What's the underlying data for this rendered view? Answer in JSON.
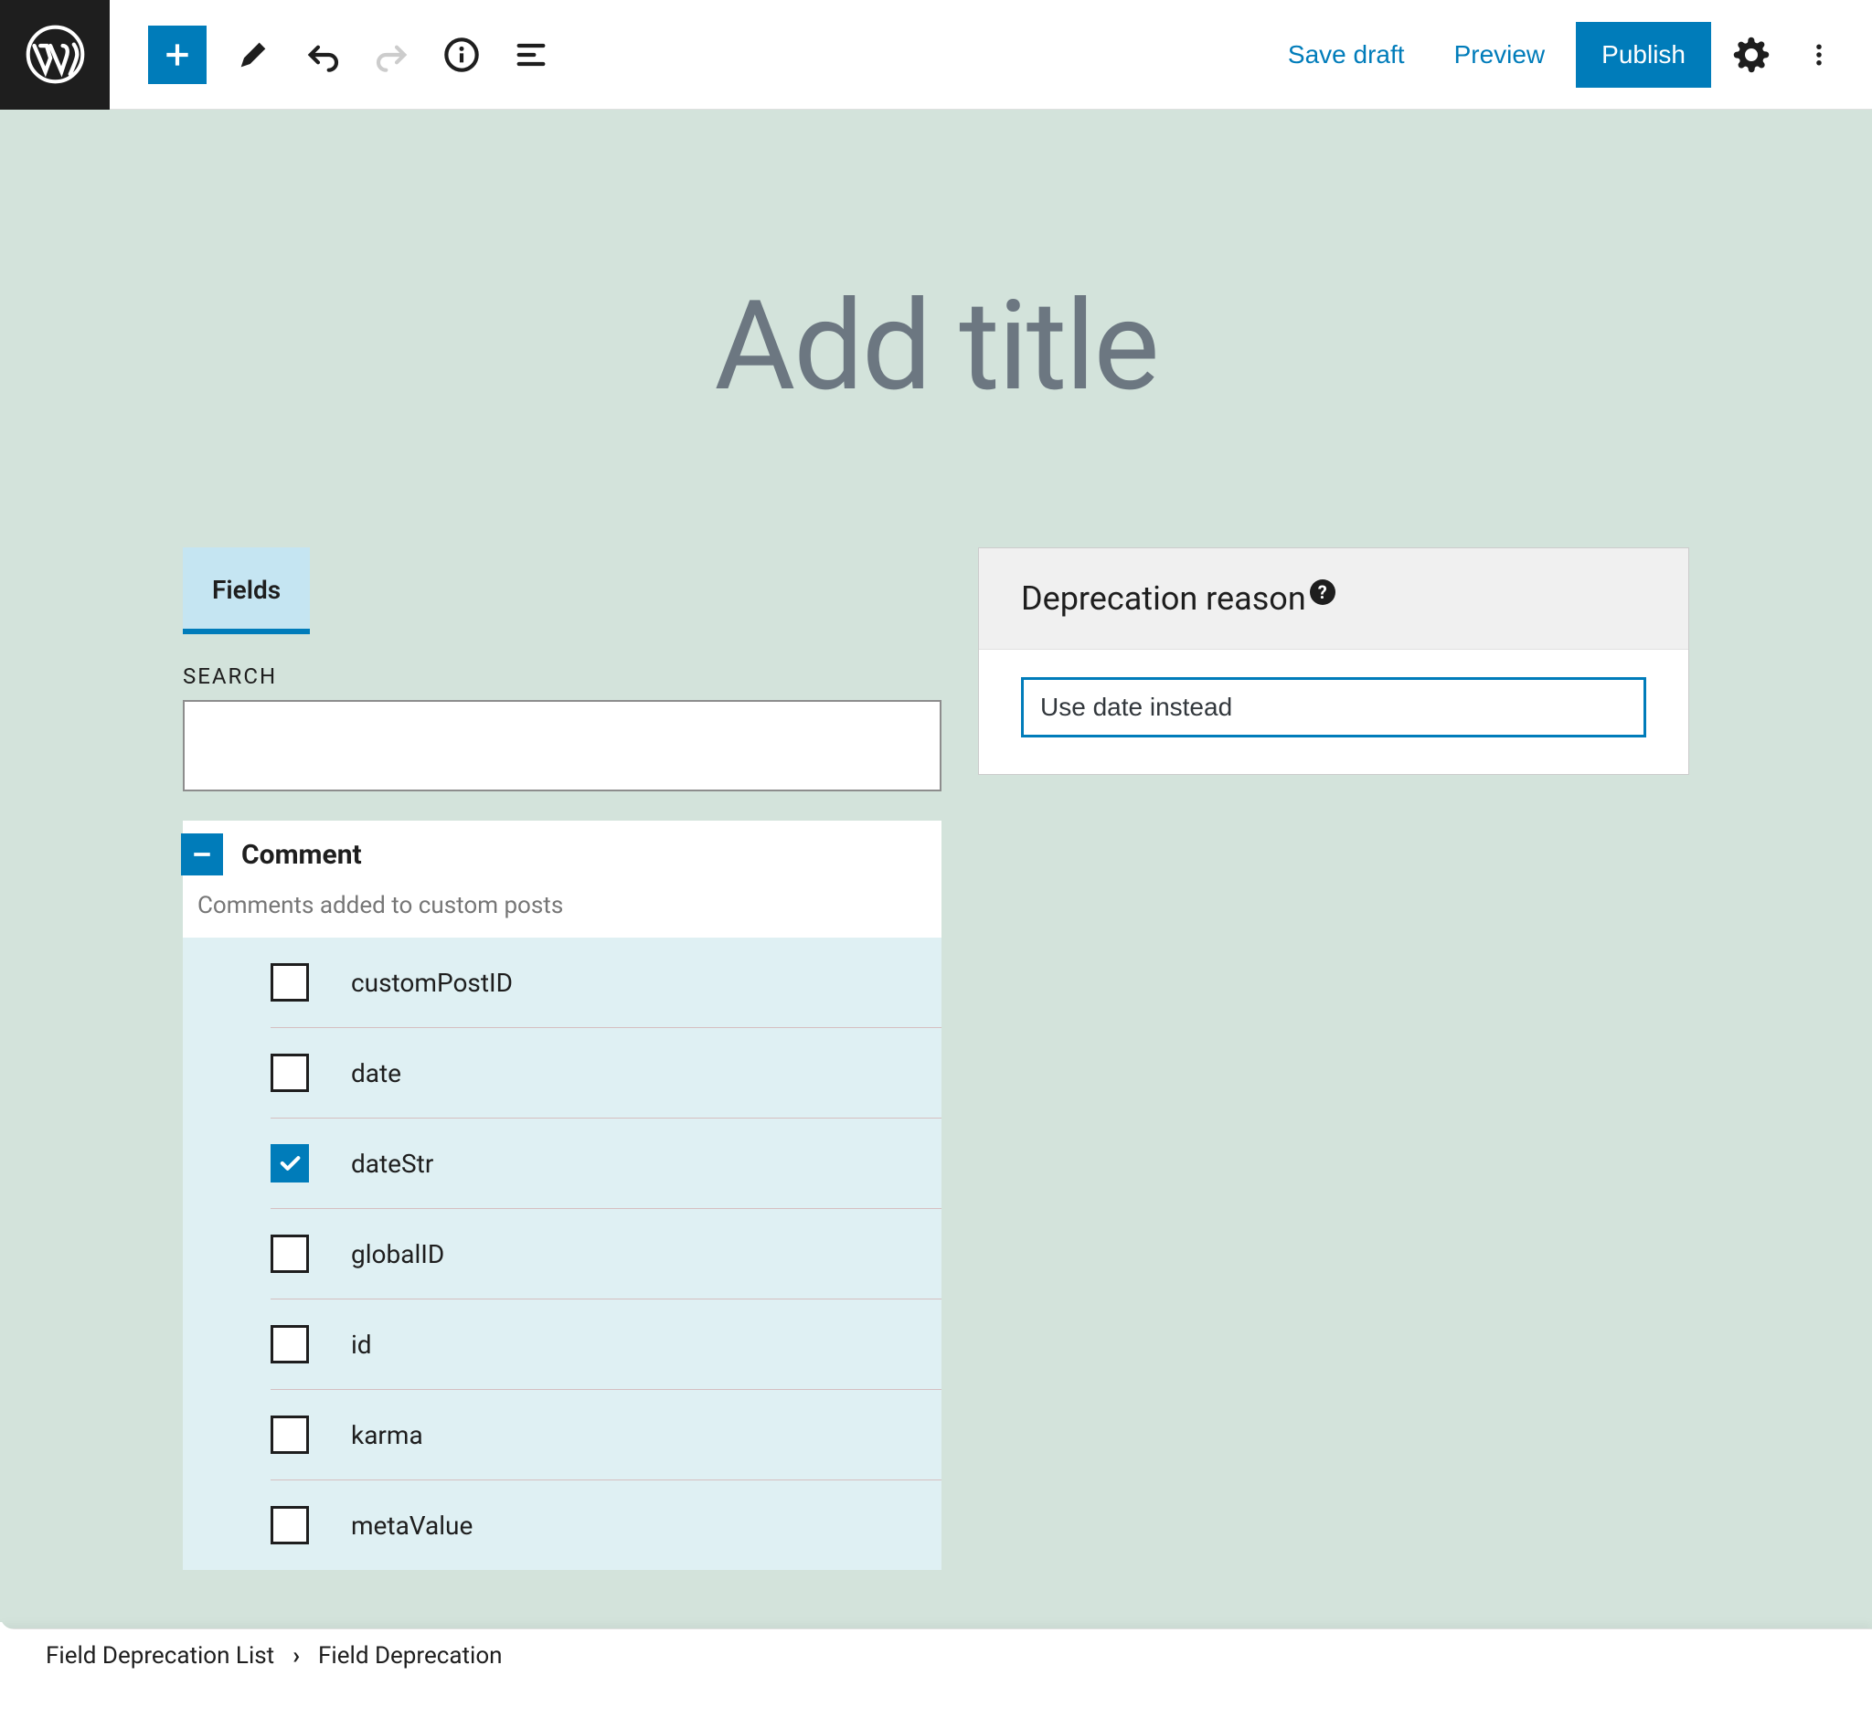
{
  "toolbar": {
    "save_draft": "Save draft",
    "preview": "Preview",
    "publish": "Publish"
  },
  "editor": {
    "title_placeholder": "Add title"
  },
  "fields_block": {
    "tab_label": "Fields",
    "search_label": "SEARCH",
    "search_value": "",
    "group": {
      "title": "Comment",
      "description": "Comments added to custom posts",
      "items": [
        {
          "label": "customPostID",
          "checked": false
        },
        {
          "label": "date",
          "checked": false
        },
        {
          "label": "dateStr",
          "checked": true
        },
        {
          "label": "globalID",
          "checked": false
        },
        {
          "label": "id",
          "checked": false
        },
        {
          "label": "karma",
          "checked": false
        },
        {
          "label": "metaValue",
          "checked": false
        }
      ]
    }
  },
  "deprecation_block": {
    "title": "Deprecation reason",
    "value": "Use date instead"
  },
  "breadcrumb": {
    "root": "Field Deprecation List",
    "current": "Field Deprecation"
  }
}
